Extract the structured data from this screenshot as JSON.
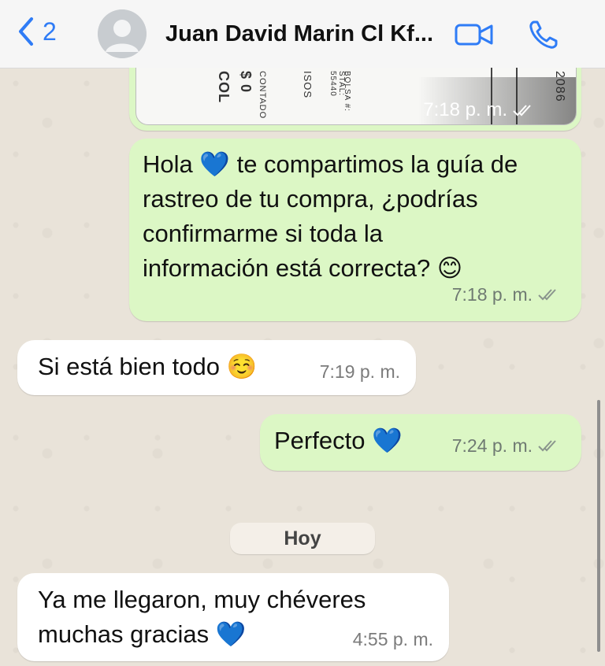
{
  "header": {
    "back_count": "2",
    "contact_name": "Juan David Marin Cl Kf..."
  },
  "receipt_image": {
    "texts": [
      "COL",
      "$ 0",
      "CONTADO",
      "ISOS",
      "BOLSA #:",
      "STAL: 55440",
      "2086"
    ],
    "time": "7:18 p. m."
  },
  "messages": [
    {
      "direction": "outgoing",
      "text_lines": [
        "Hola 💙 te compartimos la guía de",
        "rastreo de tu compra, ¿podrías",
        "confirmarme si toda la",
        "información está correcta? 😊"
      ],
      "time": "7:18 p. m.",
      "status": "read"
    },
    {
      "direction": "incoming",
      "text": "Si está bien todo ☺️",
      "time": "7:19 p. m."
    },
    {
      "direction": "outgoing",
      "text": "Perfecto 💙",
      "time": "7:24 p. m.",
      "status": "read"
    },
    {
      "direction": "incoming",
      "text_lines": [
        "Ya me llegaron, muy chéveres",
        "muchas gracias 💙"
      ],
      "time": "4:55 p. m."
    }
  ],
  "date_separator": "Hoy",
  "colors": {
    "accent": "#2f7cf6",
    "outgoing_bubble": "#dcf7c5",
    "incoming_bubble": "#ffffff",
    "wallpaper": "#e9e3d9"
  },
  "icons": [
    "chevron-left-icon",
    "avatar-placeholder-icon",
    "video-call-icon",
    "phone-icon",
    "double-check-icon"
  ]
}
